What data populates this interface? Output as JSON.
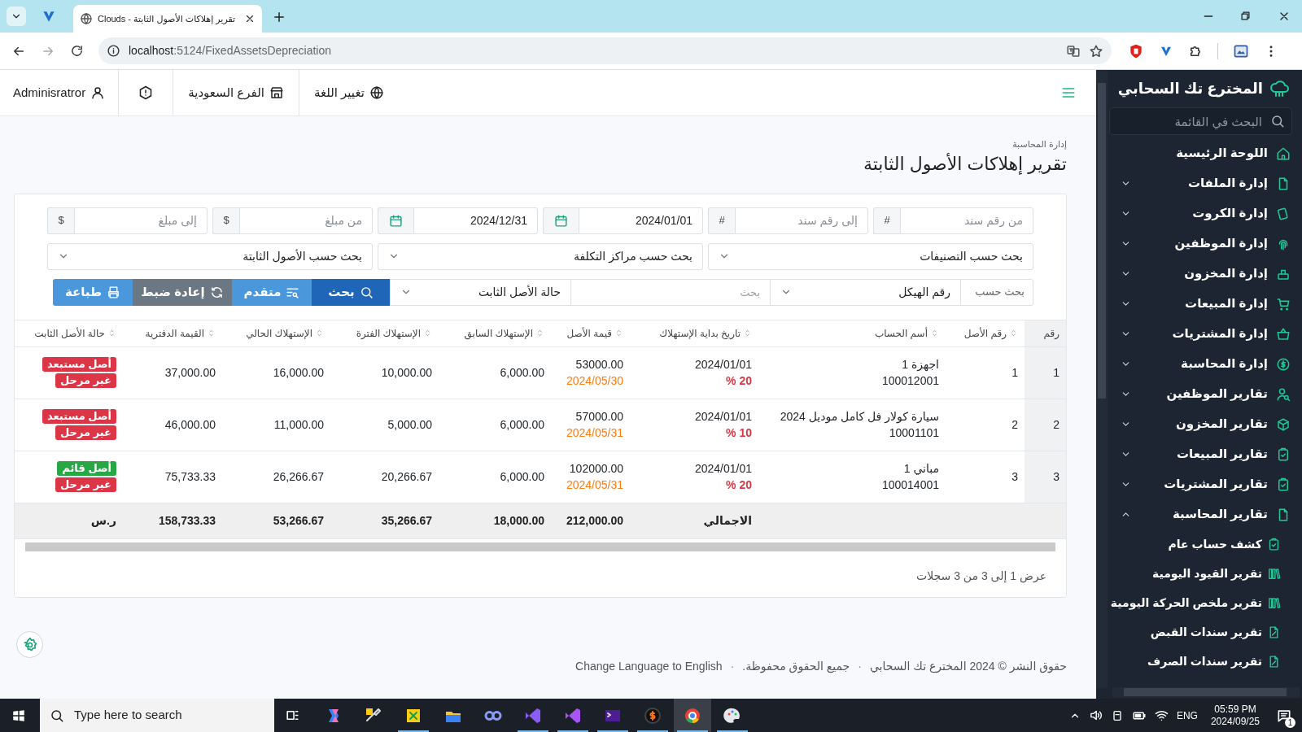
{
  "browser": {
    "tabs": [
      {
        "title": "تقرير إهلاكات الأصول الثابتة - Clouds",
        "selected": true
      }
    ],
    "url": {
      "host": "localhost",
      "path": ":5124/FixedAssetsDepreciation"
    }
  },
  "header": {
    "language": "تغيير اللغة",
    "branch": "الفرع السعودية",
    "user": "Adminisratror"
  },
  "page": {
    "breadcrumb": "إدارة المحاسبة",
    "title": "تقرير إهلاكات الأصول الثابتة"
  },
  "filters": {
    "range_fields": [
      {
        "kind": "text",
        "placeholder": "من رقم سند",
        "addon": "#"
      },
      {
        "kind": "text",
        "placeholder": "إلى رقم سند",
        "addon": "#"
      },
      {
        "kind": "date",
        "value": "2024/01/01"
      },
      {
        "kind": "date",
        "value": "2024/12/31"
      },
      {
        "kind": "text",
        "placeholder": "من مبلغ",
        "addon": "$"
      },
      {
        "kind": "text",
        "placeholder": "إلى مبلغ",
        "addon": "$"
      }
    ],
    "selects": [
      "بحث حسب التصنيفات",
      "بحث حسب مراكز التكلفة",
      "بحث حسب الأصول الثابتة"
    ],
    "search_by": {
      "label": "بحث حسب",
      "field": "رقم الهيكل",
      "placeholder": "بحث",
      "status": "حالة الأصل الثابت"
    },
    "buttons": [
      {
        "kind": "search",
        "label": "بحث"
      },
      {
        "kind": "advanced",
        "label": "متقدم"
      },
      {
        "kind": "reset",
        "label": "إعادة ضبط"
      },
      {
        "kind": "print",
        "label": "طباعة"
      }
    ]
  },
  "table": {
    "columns": [
      "رقم",
      "رقم الأصل",
      "أسم الحساب",
      "تاريخ بداية الإستهلاك",
      "قيمة الأصل",
      "الإستهلاك السابق",
      "الإستهلاك الفترة",
      "الإستهلاك الحالي",
      "القيمة الدفترية",
      "حالة الأصل الثابت"
    ],
    "rows": [
      {
        "no": "1",
        "asset_no": "1",
        "account": "اجهزة 1",
        "account_code": "100012001",
        "start_date": "2024/01/01",
        "rate": "20 %",
        "asset_value": "53000.00",
        "value_date": "2024/05/30",
        "previous": "6,000.00",
        "period": "10,000.00",
        "current": "16,000.00",
        "book_value": "37,000.00",
        "statuses": [
          {
            "label": "أصل مستبعد",
            "color": "#dc3545"
          },
          {
            "label": "غير مرحل",
            "color": "#dc3545"
          }
        ]
      },
      {
        "no": "2",
        "asset_no": "2",
        "account": "سيارة كولار فل كامل موديل 2024",
        "account_code": "10001101",
        "start_date": "2024/01/01",
        "rate": "10 %",
        "asset_value": "57000.00",
        "value_date": "2024/05/31",
        "previous": "6,000.00",
        "period": "5,000.00",
        "current": "11,000.00",
        "book_value": "46,000.00",
        "statuses": [
          {
            "label": "أصل مستبعد",
            "color": "#dc3545"
          },
          {
            "label": "غير مرحل",
            "color": "#dc3545"
          }
        ]
      },
      {
        "no": "3",
        "asset_no": "3",
        "account": "مباني 1",
        "account_code": "100014001",
        "start_date": "2024/01/01",
        "rate": "20 %",
        "asset_value": "102000.00",
        "value_date": "2024/05/31",
        "previous": "6,000.00",
        "period": "20,266.67",
        "current": "26,266.67",
        "book_value": "75,733.33",
        "statuses": [
          {
            "label": "أصل قائم",
            "color": "#28a745"
          },
          {
            "label": "غير مرحل",
            "color": "#dc3545"
          }
        ]
      }
    ],
    "totals": {
      "label": "الاجمالي",
      "asset_value": "212,000.00",
      "previous": "18,000.00",
      "period": "35,266.67",
      "current": "53,266.67",
      "book_value": "158,733.33",
      "currency": "ر.س"
    }
  },
  "pagination": "عرض 1 إلى 3 من 3 سجلات",
  "footer": [
    {
      "kind": "text",
      "text": "حقوق النشر © 2024 المخترع تك السحابي"
    },
    {
      "kind": "separator",
      "text": "·"
    },
    {
      "kind": "text",
      "text": "جميع الحقوق محفوظة."
    },
    {
      "kind": "separator",
      "text": "·"
    },
    {
      "kind": "link",
      "text": "Change Language to English"
    }
  ],
  "sidebar": {
    "brand": "المخترع تك السحابي",
    "search_placeholder": "البحث في القائمة",
    "items": [
      {
        "label": "اللوحة الرئيسية"
      },
      {
        "label": "إدارة الملفات",
        "expanded": false
      },
      {
        "label": "إدارة الكروت",
        "expanded": false
      },
      {
        "label": "إدارة الموظفين",
        "expanded": false
      },
      {
        "label": "إدارة المخزون",
        "expanded": false
      },
      {
        "label": "إدارة المبيعات",
        "expanded": false
      },
      {
        "label": "إدارة المشتريات",
        "expanded": false
      },
      {
        "label": "إدارة المحاسبة",
        "expanded": false
      },
      {
        "label": "تقارير الموظفين",
        "expanded": false
      },
      {
        "label": "تقارير المخزون",
        "expanded": false
      },
      {
        "label": "تقارير المبيعات",
        "expanded": false
      },
      {
        "label": "تقارير المشتريات",
        "expanded": false
      },
      {
        "label": "تقارير المحاسبة",
        "expanded": true,
        "children": [
          {
            "label": "كشف حساب عام"
          },
          {
            "label": "تقرير القيود اليومية"
          },
          {
            "label": "تقرير ملخص الحركة اليومية"
          },
          {
            "label": "تقرير سندات القبض"
          },
          {
            "label": "تقرير سندات الصرف"
          }
        ]
      }
    ]
  },
  "taskbar": {
    "search_placeholder": "Type here to search",
    "apps": [
      {
        "running": false,
        "selected": false
      },
      {
        "running": false,
        "selected": false
      },
      {
        "running": true,
        "selected": false
      },
      {
        "running": false,
        "selected": false
      },
      {
        "running": false,
        "selected": false
      },
      {
        "running": true,
        "selected": false
      },
      {
        "running": true,
        "selected": false
      },
      {
        "running": true,
        "selected": false
      },
      {
        "running": true,
        "selected": false
      },
      {
        "running": true,
        "selected": true
      },
      {
        "running": true,
        "selected": false
      }
    ],
    "language": "ENG",
    "time": "05:59 PM",
    "date": "2024/09/25",
    "notifications": "1"
  }
}
